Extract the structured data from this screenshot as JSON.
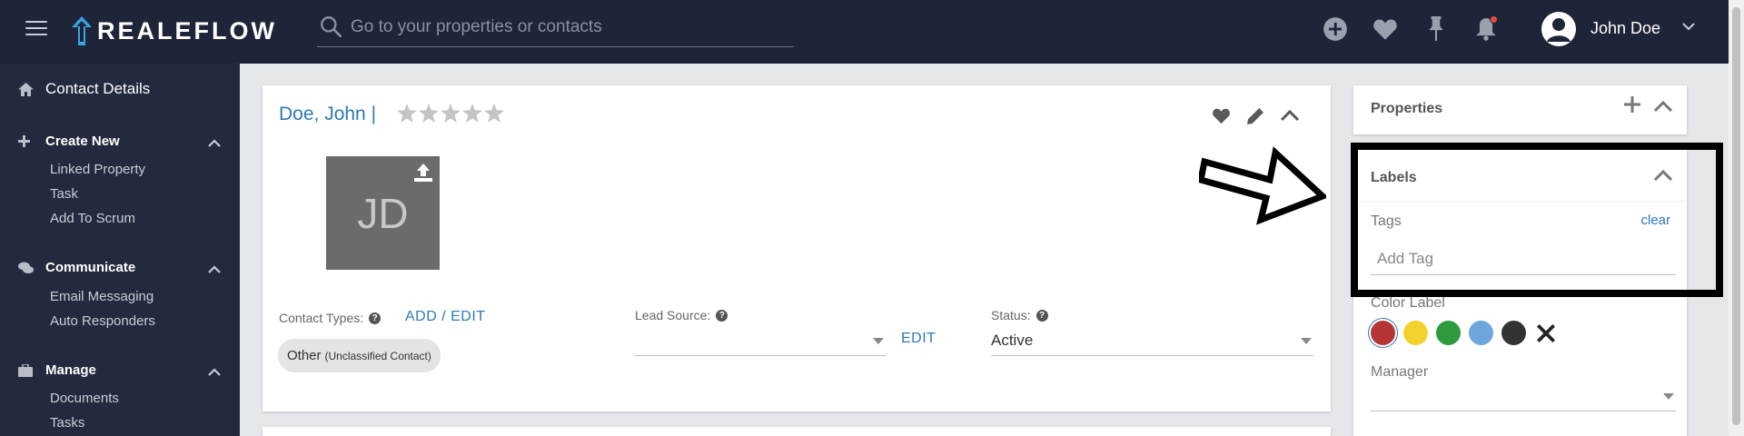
{
  "header": {
    "brand": "REALEFLOW",
    "search_placeholder": "Go to your properties or contacts",
    "user_name": "John Doe"
  },
  "sidebar": {
    "title": "Contact Details",
    "sections": [
      {
        "label": "Create New",
        "items": [
          "Linked Property",
          "Task",
          "Add To Scrum"
        ]
      },
      {
        "label": "Communicate",
        "items": [
          "Email Messaging",
          "Auto Responders"
        ]
      },
      {
        "label": "Manage",
        "items": [
          "Documents",
          "Tasks"
        ]
      }
    ]
  },
  "contact": {
    "name": "Doe, John |",
    "rating": 0,
    "initials": "JD",
    "contact_types_label": "Contact Types:",
    "add_edit_label": "ADD / EDIT",
    "type_chip": "Other",
    "type_chip_note": "(Unclassified Contact)",
    "lead_source_label": "Lead Source:",
    "lead_source_value": "",
    "edit_label": "EDIT",
    "status_label": "Status:",
    "status_value": "Active"
  },
  "properties_panel": {
    "title": "Properties"
  },
  "labels_panel": {
    "title": "Labels",
    "tags_label": "Tags",
    "clear_label": "clear",
    "tag_placeholder": "Add Tag",
    "color_label": "Color Label",
    "colors": [
      "#b53535",
      "#f4d22e",
      "#2f9a3d",
      "#6ca6dc",
      "#333333"
    ],
    "selected_color": "#b53535",
    "manager_label": "Manager",
    "manager_value": ""
  },
  "colors": {
    "topbar": "#1f2538",
    "sidebar": "#232a3d",
    "accent": "#2e79b8",
    "logo_accent": "#3aa3e3"
  }
}
